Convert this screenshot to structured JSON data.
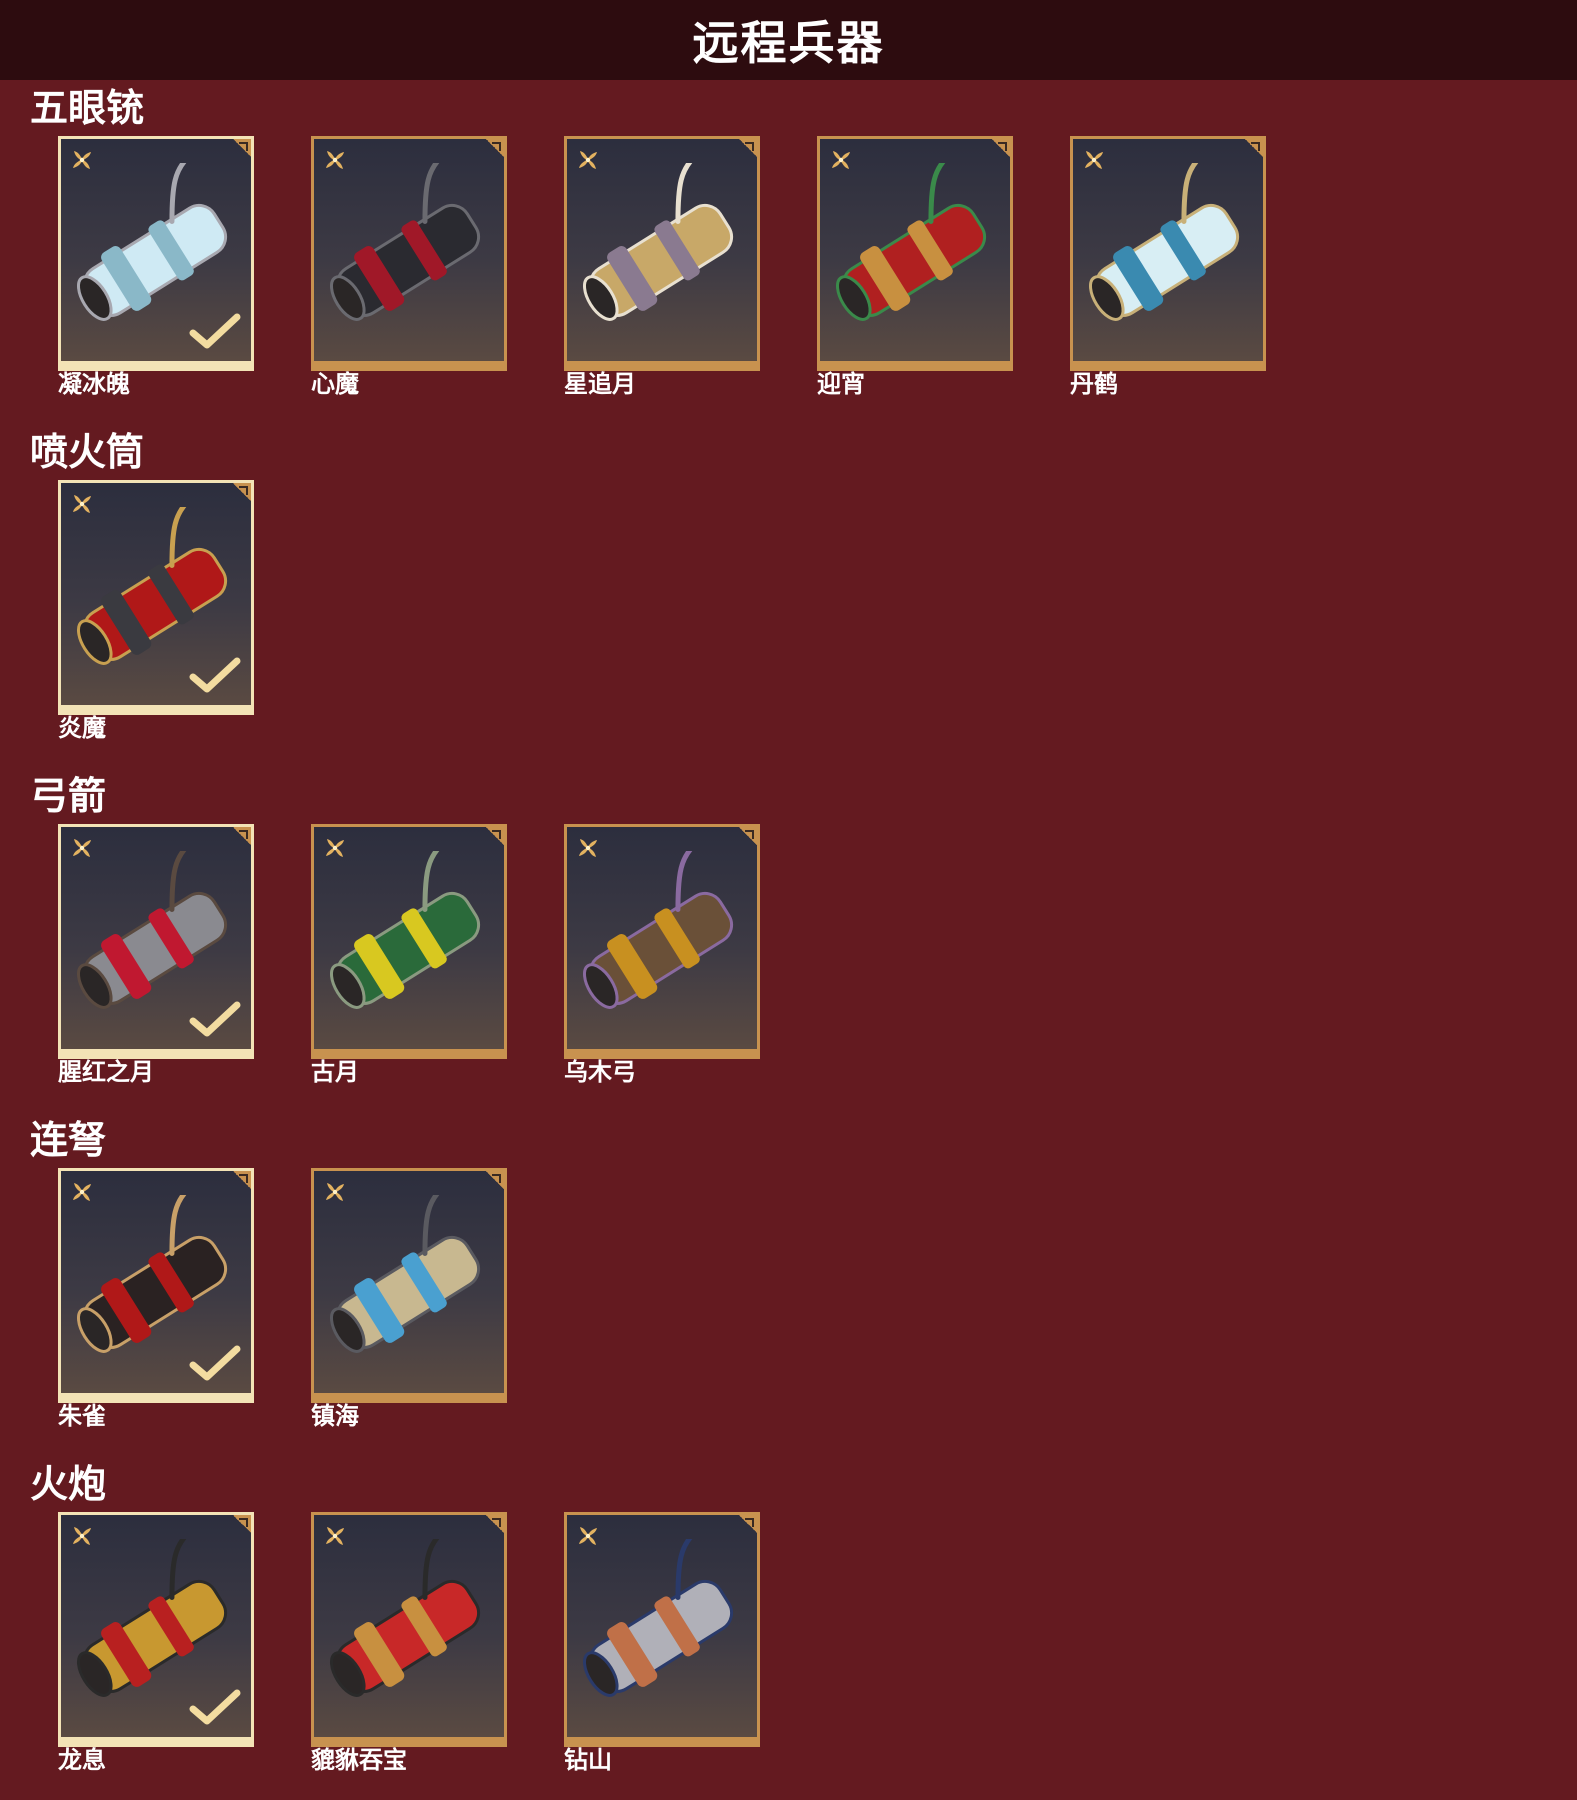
{
  "page": {
    "title": "远程兵器"
  },
  "colors": {
    "background": "#641a20",
    "header": "#2d0c0f",
    "tile_border": "#c8924f",
    "tile_border_selected": "#f3e3b6",
    "icon_gold": "#e3b260"
  },
  "icons": {
    "badge": "flower-icon",
    "owned": "check-icon",
    "corner": "corner-mark"
  },
  "sections": [
    {
      "title": "五眼铳",
      "items": [
        {
          "name": "凝冰魄",
          "selected": true,
          "theme": [
            "#cfeaf4",
            "#8ab8c8",
            "#a8a8b0"
          ]
        },
        {
          "name": "心魔",
          "selected": false,
          "theme": [
            "#2a2a30",
            "#a01828",
            "#6a6a70"
          ]
        },
        {
          "name": "星追月",
          "selected": false,
          "theme": [
            "#c8a868",
            "#8a7a90",
            "#e8e0d0"
          ]
        },
        {
          "name": "迎宵",
          "selected": false,
          "theme": [
            "#b02020",
            "#c89040",
            "#3a8a4a"
          ]
        },
        {
          "name": "丹鹤",
          "selected": false,
          "theme": [
            "#d8eef4",
            "#3a8ab0",
            "#c8b078"
          ]
        }
      ]
    },
    {
      "title": "喷火筒",
      "items": [
        {
          "name": "炎魔",
          "selected": true,
          "theme": [
            "#b01818",
            "#3a3a40",
            "#c8a050"
          ]
        }
      ]
    },
    {
      "title": "弓箭",
      "items": [
        {
          "name": "腥红之月",
          "selected": true,
          "theme": [
            "#8a8a90",
            "#c01830",
            "#5a4a40"
          ]
        },
        {
          "name": "古月",
          "selected": false,
          "theme": [
            "#2a6a3a",
            "#d8c820",
            "#8a9a80"
          ]
        },
        {
          "name": "乌木弓",
          "selected": false,
          "theme": [
            "#6a5038",
            "#c89020",
            "#8a6aa0"
          ]
        }
      ]
    },
    {
      "title": "连弩",
      "items": [
        {
          "name": "朱雀",
          "selected": true,
          "theme": [
            "#2a2222",
            "#b01818",
            "#c8a068"
          ]
        },
        {
          "name": "镇海",
          "selected": false,
          "theme": [
            "#c8b890",
            "#4aa0d0",
            "#5a5a60"
          ]
        }
      ]
    },
    {
      "title": "火炮",
      "items": [
        {
          "name": "龙息",
          "selected": true,
          "theme": [
            "#c89830",
            "#b82020",
            "#2a2a2a"
          ]
        },
        {
          "name": "貔貅吞宝",
          "selected": false,
          "theme": [
            "#c82828",
            "#c89040",
            "#2a2a2a"
          ]
        },
        {
          "name": "钻山",
          "selected": false,
          "theme": [
            "#b0b0b8",
            "#c07048",
            "#2a3a6a"
          ]
        }
      ]
    }
  ]
}
